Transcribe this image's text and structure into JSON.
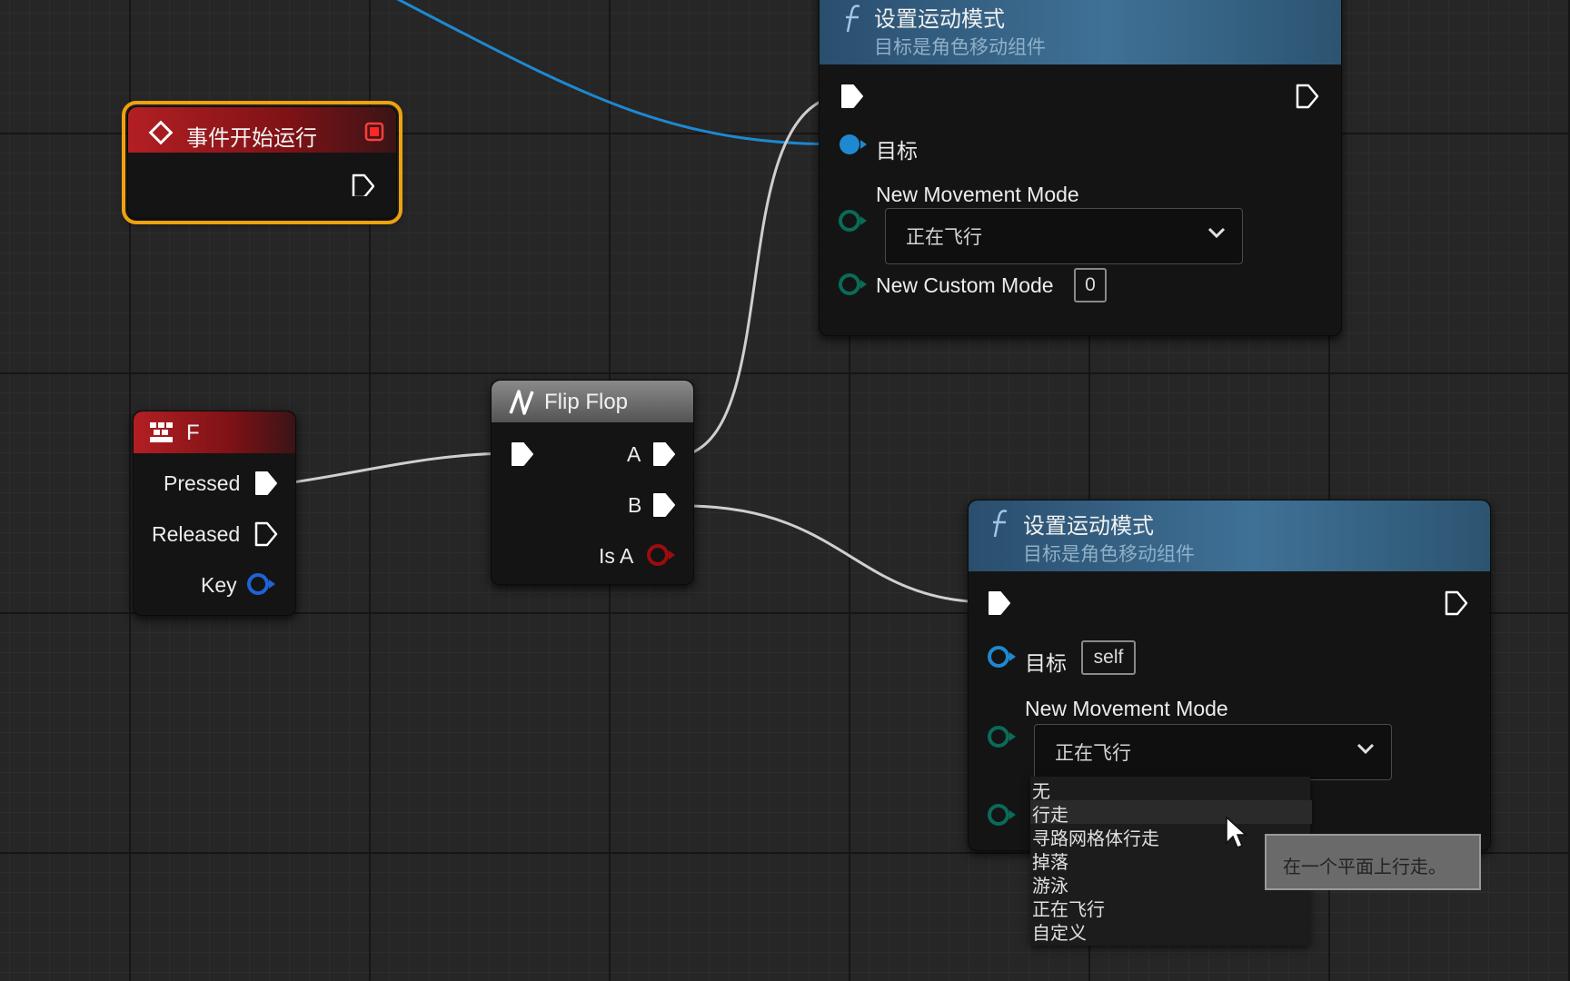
{
  "event_begin_play": {
    "title": "事件开始运行"
  },
  "key_f": {
    "title": "F",
    "pins": {
      "pressed": "Pressed",
      "released": "Released",
      "key": "Key"
    }
  },
  "flip_flop": {
    "title": "Flip Flop",
    "pins": {
      "a": "A",
      "b": "B",
      "is_a": "Is A"
    }
  },
  "set_mode_1": {
    "title": "设置运动模式",
    "subtitle": "目标是角色移动组件",
    "target_label": "目标",
    "movement_mode_label": "New Movement Mode",
    "movement_mode_value": "正在飞行",
    "custom_mode_label": "New Custom Mode",
    "custom_mode_value": "0"
  },
  "set_mode_2": {
    "title": "设置运动模式",
    "subtitle": "目标是角色移动组件",
    "target_label": "目标",
    "target_value": "self",
    "movement_mode_label": "New Movement Mode",
    "movement_mode_value": "正在飞行"
  },
  "mode_menu": {
    "options": [
      "无",
      "行走",
      "寻路网格体行走",
      "掉落",
      "游泳",
      "正在飞行",
      "自定义"
    ],
    "hovered": "行走"
  },
  "tooltip": {
    "text": "在一个平面上行走。"
  },
  "colors": {
    "exec_wire": "#d7d7d7",
    "object_wire": "#1e88d0",
    "event_header": "#b21f23",
    "function_header": "#3f7196",
    "selection_outline": "#f0a10f"
  }
}
